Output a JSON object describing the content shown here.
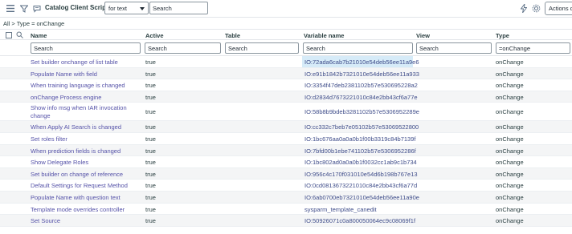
{
  "toolbar": {
    "title": "Catalog Client Scripts",
    "search_field_selected": "for text",
    "search_placeholder": "Search",
    "actions_label": "Actions o"
  },
  "breadcrumb": "All > Type = onChange",
  "columns": {
    "name": "Name",
    "active": "Active",
    "table": "Table",
    "variable_name": "Variable name",
    "view": "View",
    "type": "Type"
  },
  "filters": {
    "name": "Search",
    "active": "Search",
    "table": "Search",
    "variable_name": "Search",
    "view": "Search",
    "type": "=onChange"
  },
  "rows": [
    {
      "name": "Set builder onchange of list table",
      "active": "true",
      "variable": "IO:72ada6cab7b21010e54deb56ee11a9e6",
      "type": "onChange"
    },
    {
      "name": "Populate Name with field",
      "active": "true",
      "variable": "IO:e91b1842b7321010e54deb56ee11a933",
      "type": "onChange"
    },
    {
      "name": "When training language is changed",
      "active": "true",
      "variable": "IO:3354f47deb2381102b57e530695228a2",
      "type": "onChange"
    },
    {
      "name": "onChange Process engine",
      "active": "true",
      "variable": "IO:d2834d7673221010c84e2bb43cf6a77e",
      "type": "onChange"
    },
    {
      "name": "Show info msg when IAR invocation change",
      "active": "true",
      "variable": "IO:58b8b9bdeb3281102b57e5306952289e",
      "type": "onChange"
    },
    {
      "name": "When Apply AI Search is changed",
      "active": "true",
      "variable": "IO:cc332c7beb7e05102b57e53069522800",
      "type": "onChange"
    },
    {
      "name": "Set roles filter",
      "active": "true",
      "variable": "IO:1bc676aa0a0a0b1f00b3319c84b7139f",
      "type": "onChange"
    },
    {
      "name": "When prediction fields is changed",
      "active": "true",
      "variable": "IO:7bfd00b1ebe741102b57e5306952286f",
      "type": "onChange"
    },
    {
      "name": "Show Delegate Roles",
      "active": "true",
      "variable": "IO:1bc802ad0a0a0b1f0032cc1ab9c1b734",
      "type": "onChange"
    },
    {
      "name": "Set builder on change of reference",
      "active": "true",
      "variable": "IO:956c4c170f031010e54d6b198b767e13",
      "type": "onChange"
    },
    {
      "name": "Default Settings for Request Method",
      "active": "true",
      "variable": "IO:0cd0813673221010c84e2bb43cf6a77d",
      "type": "onChange"
    },
    {
      "name": "Populate Name with question text",
      "active": "true",
      "variable": "IO:6ab0700eb7321010e54deb56ee11a90e",
      "type": "onChange"
    },
    {
      "name": "Template mode overrides controller",
      "active": "true",
      "variable": "sysparm_template_canedit",
      "type": "onChange"
    },
    {
      "name": "Set Source",
      "active": "true",
      "variable": "IO:50926071c0a800050064ec9c08069f1f",
      "type": "onChange"
    }
  ]
}
